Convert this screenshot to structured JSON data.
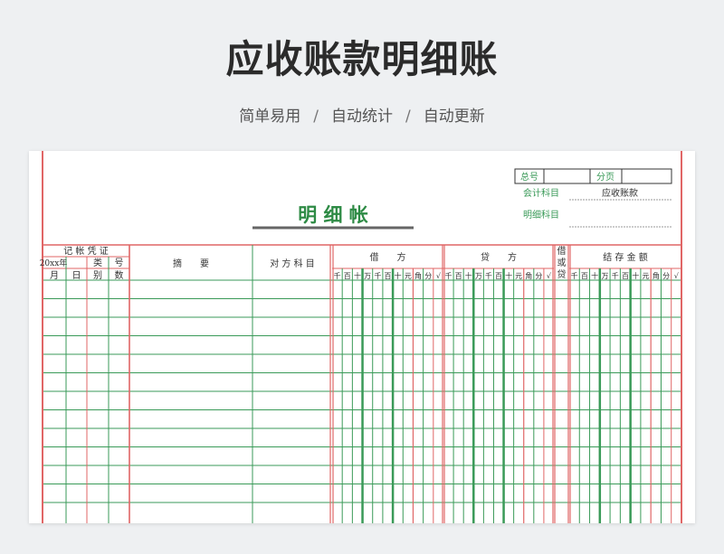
{
  "page": {
    "title": "应收账款明细账",
    "features": [
      "简单易用",
      "自动统计",
      "自动更新"
    ],
    "separator": "/"
  },
  "ledger": {
    "title": "明 细 帐",
    "top_right": {
      "total_label": "总号",
      "total_value": "",
      "page_label": "分页",
      "page_value": "",
      "account_label": "会计科目",
      "account_value": "应收账款",
      "subaccount_label": "明细科目",
      "subaccount_value": ""
    },
    "voucher_header": "记 帐 凭 证",
    "year_label": "20xx年",
    "type_label": "类",
    "number_label": "号",
    "month_label": "月",
    "day_label": "日",
    "category_label": "别",
    "count_label": "数",
    "summary_header": "摘　　要",
    "counter_account_header": "对 方 科 目",
    "debit_header": "借　　方",
    "credit_header": "贷　　方",
    "dc_header_1": "借",
    "dc_header_2": "或",
    "dc_header_3": "贷",
    "balance_header": "结 存 金 额",
    "amount_digits": [
      "千",
      "百",
      "十",
      "万",
      "千",
      "百",
      "十",
      "元",
      "角",
      "分",
      "√"
    ],
    "row_count": 13,
    "colors": {
      "red": "#e06666",
      "green": "#3a9a58",
      "title_green": "#2e8b45",
      "title_underline": "#666666"
    }
  }
}
